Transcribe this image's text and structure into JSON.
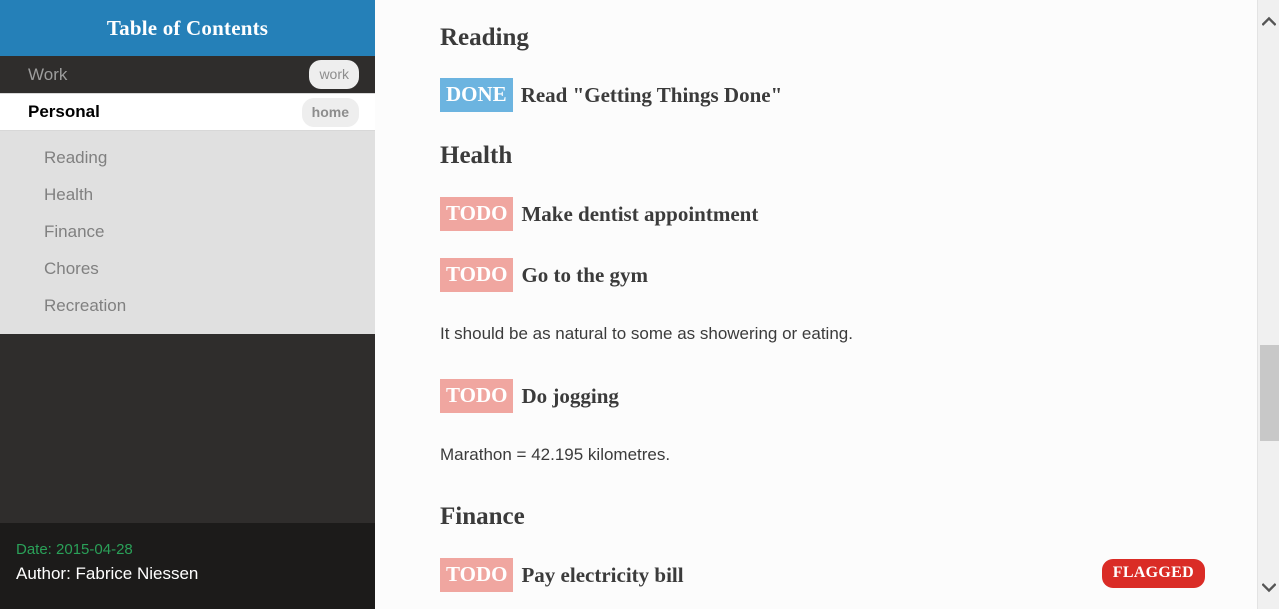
{
  "sidebar": {
    "header": {
      "title": "Table of Contents"
    },
    "items": [
      {
        "label": "Work",
        "tag": "work",
        "level": 1,
        "active": false
      },
      {
        "label": "Personal",
        "tag": "home",
        "level": 1,
        "active": true
      }
    ],
    "subitems": [
      {
        "label": "Reading"
      },
      {
        "label": "Health"
      },
      {
        "label": "Finance"
      },
      {
        "label": "Chores"
      },
      {
        "label": "Recreation"
      }
    ],
    "footer": {
      "date": "Date: 2015-04-28",
      "author": "Author: Fabrice Niessen"
    }
  },
  "content": {
    "blocks": [
      {
        "kind": "heading",
        "text": "Reading"
      },
      {
        "kind": "todo",
        "keyword": "DONE",
        "text": "Read \"Getting Things Done\""
      },
      {
        "kind": "heading",
        "text": "Health"
      },
      {
        "kind": "todo",
        "keyword": "TODO",
        "text": "Make dentist appointment"
      },
      {
        "kind": "todo",
        "keyword": "TODO",
        "text": "Go to the gym"
      },
      {
        "kind": "para",
        "text": "It should be as natural to some as showering or eating."
      },
      {
        "kind": "todo",
        "keyword": "TODO",
        "text": "Do jogging"
      },
      {
        "kind": "para",
        "text": "Marathon = 42.195 kilometres."
      },
      {
        "kind": "heading",
        "text": "Finance"
      },
      {
        "kind": "todo",
        "keyword": "TODO",
        "text": "Pay electricity bill",
        "flag": "FLAGGED"
      }
    ]
  },
  "scrollbar": {
    "up_glyph": "⌃",
    "down_glyph": "⌄"
  },
  "colors": {
    "header_blue": "#2580b8",
    "sidebar_dark": "#2f2d2c",
    "sidebar_footer": "#1c1b1a",
    "sublist_gray": "#e0e0e0",
    "date_green": "#2aa058",
    "todo_pink": "#f0a6a0",
    "done_blue": "#6cb4e0",
    "flag_red": "#da2c26"
  }
}
